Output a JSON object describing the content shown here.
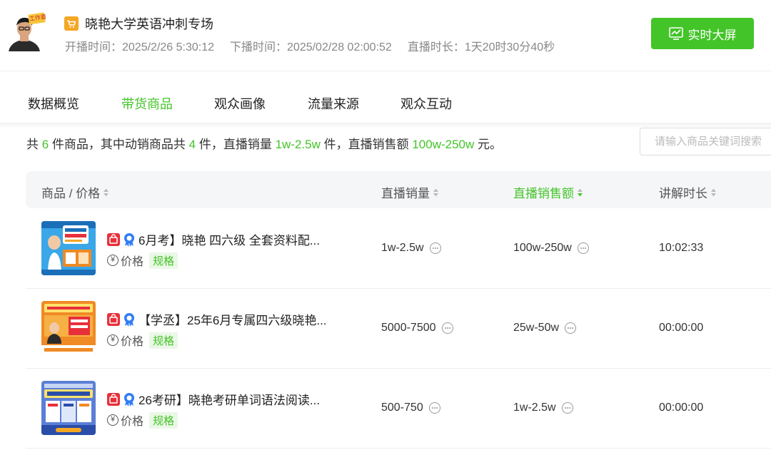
{
  "header": {
    "title": "晓艳大学英语冲刺专场",
    "start_time": "开播时间：2025/2/26 5:30:12",
    "end_time": "下播时间：2025/02/28 02:00:52",
    "duration": "直播时长：1天20时30分40秒",
    "live_screen_button": "实时大屏",
    "avatar_banner": "工作直播"
  },
  "tabs": [
    {
      "label": "数据概览"
    },
    {
      "label": "带货商品"
    },
    {
      "label": "观众画像"
    },
    {
      "label": "流量来源"
    },
    {
      "label": "观众互动"
    }
  ],
  "active_tab": "带货商品",
  "summary": {
    "p1": "共 ",
    "total": "6",
    "p2": " 件商品，其中动销商品共 ",
    "active_count": "4",
    "p3": " 件，直播销量 ",
    "sales_volume": "1w-2.5w",
    "p4": " 件，直播销售额 ",
    "sales_amount": "100w-250w",
    "p5": " 元。"
  },
  "search": {
    "placeholder": "请输入商品关键词搜索"
  },
  "columns": {
    "product": "商品 / 价格",
    "volume": "直播销量",
    "amount": "直播销售额",
    "explain": "讲解时长"
  },
  "sorted_column": "直播销售额",
  "price_label": "价格",
  "spec_label": "规格",
  "yuan_symbol": "¥",
  "rows": [
    {
      "title": "6月考】晓艳 四六级 全套资料配...",
      "volume": "1w-2.5w",
      "amount": "100w-250w",
      "explain": "10:02:33"
    },
    {
      "title": "【学丞】25年6月专属四六级晓艳...",
      "volume": "5000-7500",
      "amount": "25w-50w",
      "explain": "00:00:00"
    },
    {
      "title": "26考研】晓艳考研单词语法阅读...",
      "volume": "500-750",
      "amount": "1w-2.5w",
      "explain": "00:00:00"
    }
  ],
  "colors": {
    "accent": "#43c428",
    "badge_red": "#e8303a",
    "badge_blue": "#2f7cf6"
  }
}
